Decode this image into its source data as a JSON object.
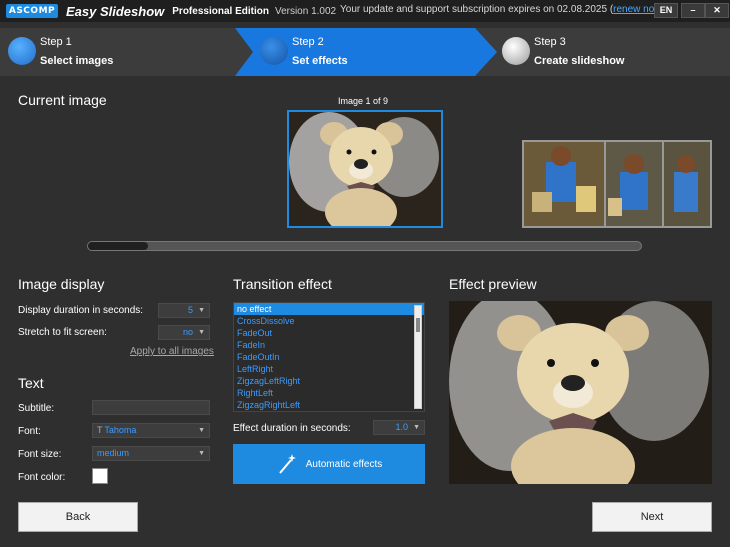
{
  "titlebar": {
    "logo": "ASCOMP",
    "app_name": "Easy Slideshow",
    "edition": "Professional Edition",
    "version": "Version 1.002",
    "subscription_text": "Your update and support subscription expires on 02.08.2025 (",
    "renew_link": "renew now",
    "subscription_close": ")",
    "lang_button": "EN",
    "minimize": "–",
    "close": "✕"
  },
  "steps": [
    {
      "num": "Step 1",
      "label": "Select images"
    },
    {
      "num": "Step 2",
      "label": "Set effects"
    },
    {
      "num": "Step 3",
      "label": "Create slideshow"
    }
  ],
  "current_image": {
    "title": "Current image",
    "counter": "Image 1 of 9"
  },
  "image_display": {
    "title": "Image display",
    "duration_label": "Display duration in seconds:",
    "duration_value": "5",
    "stretch_label": "Stretch to fit screen:",
    "stretch_value": "no",
    "apply_all": "Apply to all images"
  },
  "text_section": {
    "title": "Text",
    "subtitle_label": "Subtitle:",
    "subtitle_value": "",
    "font_label": "Font:",
    "font_value": "Tahoma",
    "font_size_label": "Font size:",
    "font_size_value": "medium",
    "font_color_label": "Font color:",
    "font_color": "#ffffff"
  },
  "transition": {
    "title": "Transition effect",
    "items": [
      "no effect",
      "CrossDissolve",
      "FadeOut",
      "FadeIn",
      "FadeOutIn",
      "LeftRight",
      "ZigzagLeftRight",
      "RightLeft",
      "ZigzagRightLeft"
    ],
    "selected_index": 0,
    "duration_label": "Effect duration in seconds:",
    "duration_value": "1.0",
    "auto_button": "Automatic effects"
  },
  "preview": {
    "title": "Effect preview"
  },
  "buttons": {
    "back": "Back",
    "next": "Next"
  },
  "colors": {
    "accent": "#1e8be0",
    "background": "#2f2f2f",
    "link": "#3b9bff"
  }
}
